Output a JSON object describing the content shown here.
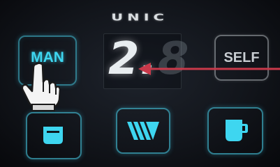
{
  "brand": {
    "logo_text": "UNIC"
  },
  "buttons": {
    "manual_label": "MAN",
    "self_label": "SELF"
  },
  "display": {
    "value_main": "2.",
    "value_dim": "8"
  },
  "icons": {
    "small_cup": "small-cup-icon",
    "brew": "brew-stripes-icon",
    "large_cup": "large-cup-icon",
    "pointer": "hand-pointer-icon",
    "annotation": "red-arrow-icon"
  },
  "colors": {
    "accent_cyan": "#3ed6f0",
    "arrow_red": "#c9394a",
    "digit_white": "#e8edf0"
  }
}
